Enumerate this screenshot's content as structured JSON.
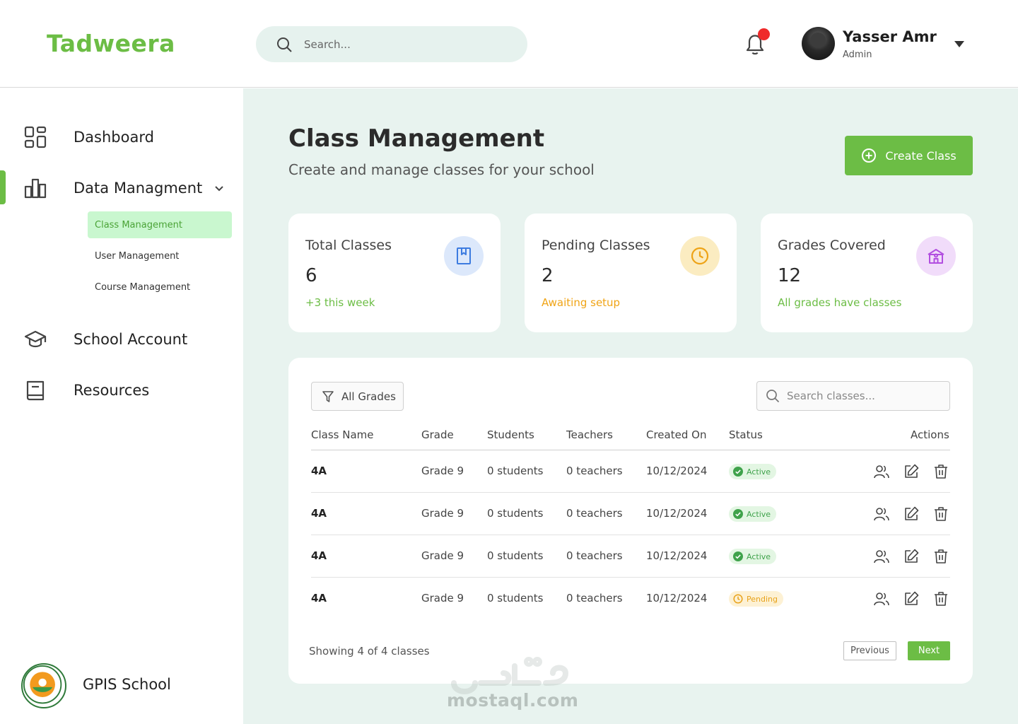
{
  "header": {
    "logo": "Tadweera",
    "search_placeholder": "Search...",
    "user": {
      "name": "Yasser Amr",
      "role": "Admin"
    },
    "notification_dot_color": "#ef2a2a"
  },
  "sidebar": {
    "items": [
      {
        "label": "Dashboard",
        "icon": "grid-icon"
      },
      {
        "label": "Data Managment",
        "icon": "bar-chart-icon",
        "expanded": true,
        "subitems": [
          {
            "label": "Class Management",
            "active": true
          },
          {
            "label": "User Management"
          },
          {
            "label": "Course Management"
          }
        ]
      },
      {
        "label": "School Account",
        "icon": "graduation-cap-icon"
      },
      {
        "label": "Resources",
        "icon": "book-icon"
      }
    ],
    "school": "GPIS School"
  },
  "main": {
    "title": "Class Management",
    "subtitle": "Create and manage classes for your school",
    "create_button": "Create Class",
    "cards": [
      {
        "title": "Total Classes",
        "value": "6",
        "note": "+3 this week",
        "note_color": "#6cbd45",
        "icon": "bookmark-book-icon"
      },
      {
        "title": "Pending Classes",
        "value": "2",
        "note": "Awaiting setup",
        "note_color": "#f0a416",
        "icon": "clock-icon"
      },
      {
        "title": "Grades Covered",
        "value": "12",
        "note": "All grades have classes",
        "note_color": "#6cbd45",
        "icon": "school-building-icon"
      }
    ],
    "table": {
      "filter_label": "All Grades",
      "search_placeholder": "Search classes...",
      "columns": [
        "Class Name",
        "Grade",
        "Students",
        "Teachers",
        "Created On",
        "Status",
        "Actions"
      ],
      "rows": [
        {
          "name": "4A",
          "grade": "Grade 9",
          "students": "0 students",
          "teachers": "0 teachers",
          "created": "10/12/2024",
          "status": "Active"
        },
        {
          "name": "4A",
          "grade": "Grade 9",
          "students": "0 students",
          "teachers": "0 teachers",
          "created": "10/12/2024",
          "status": "Active"
        },
        {
          "name": "4A",
          "grade": "Grade 9",
          "students": "0 students",
          "teachers": "0 teachers",
          "created": "10/12/2024",
          "status": "Active"
        },
        {
          "name": "4A",
          "grade": "Grade 9",
          "students": "0 students",
          "teachers": "0 teachers",
          "created": "10/12/2024",
          "status": "Pending"
        }
      ],
      "footer": "Showing 4 of 4 classes",
      "prev_label": "Previous",
      "next_label": "Next"
    }
  },
  "watermark": {
    "url": "mostaql.com"
  },
  "colors": {
    "accent": "#6cbd45",
    "main_bg": "#e8f3ef",
    "active_sub_bg": "#c9f7cf"
  }
}
